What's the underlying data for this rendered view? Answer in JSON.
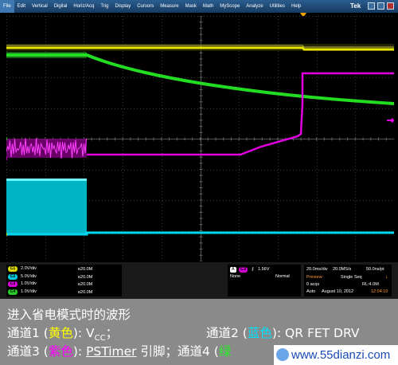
{
  "menubar": {
    "items": [
      "File",
      "Edit",
      "Vertical",
      "Digital",
      "Horiz/Acq",
      "Trig",
      "Display",
      "Cursors",
      "Measure",
      "Mask",
      "Math",
      "MyScope",
      "Analyze",
      "Utilities",
      "Help"
    ],
    "logo": "Tek"
  },
  "channels": [
    {
      "id": "C1",
      "scale": "2.0V/div",
      "bw": "20.0M",
      "color": "#d9d900"
    },
    {
      "id": "C2",
      "scale": "5.0V/div",
      "bw": "20.0M",
      "color": "#00c8e0"
    },
    {
      "id": "C3",
      "scale": "1.0V/div",
      "bw": "20.0M",
      "color": "#d400d4"
    },
    {
      "id": "C4",
      "scale": "1.0V/div",
      "bw": "20.0M",
      "color": "#22cc22"
    }
  ],
  "channel_markers": [
    {
      "id": "C4",
      "color": "#22cc22"
    },
    {
      "id": "C3",
      "color": "#d400d4"
    },
    {
      "id": "C1",
      "color": "#d9d900"
    }
  ],
  "trigger": {
    "label": "A",
    "source": "C3",
    "slope": "⨍",
    "level": "1.56V",
    "coupling": "None",
    "mode": "Normal"
  },
  "acquisition": {
    "horizontal_scale": "20.0ms/div",
    "sample_rate": "20.0MS/s",
    "resolution": "50.0ns/pt",
    "state": "Preview",
    "sequence": "Single Seq",
    "acqs": "0 acqs",
    "record_length": "RL:4.0M",
    "trigger_mode": "Auto",
    "date": "August 10, 2012",
    "time": "12:04:10"
  },
  "caption": {
    "title": "进入省电模式时的波形",
    "ch1_prefix": "通道1 (",
    "ch1_color_word": "黄色",
    "ch1_suffix": "): V",
    "ch1_sub": "CC",
    "ch1_end": "；",
    "ch2_prefix": "通道2 (",
    "ch2_color_word": "蓝色",
    "ch2_suffix": "): QR FET DRV",
    "ch3_prefix": "通道3 (",
    "ch3_color_word": "紫色",
    "ch3_suffix": "): ",
    "ch3_signal": "PSTimer",
    "ch3_end": " 引脚；",
    "ch4_prefix": "通道4 (",
    "ch4_color_word": "绿"
  },
  "watermark": "www.55dianzi.com",
  "colors": {
    "ch1": "#e6e600",
    "ch2": "#00d8f0",
    "ch3": "#e000e0",
    "ch4": "#22dd22"
  }
}
